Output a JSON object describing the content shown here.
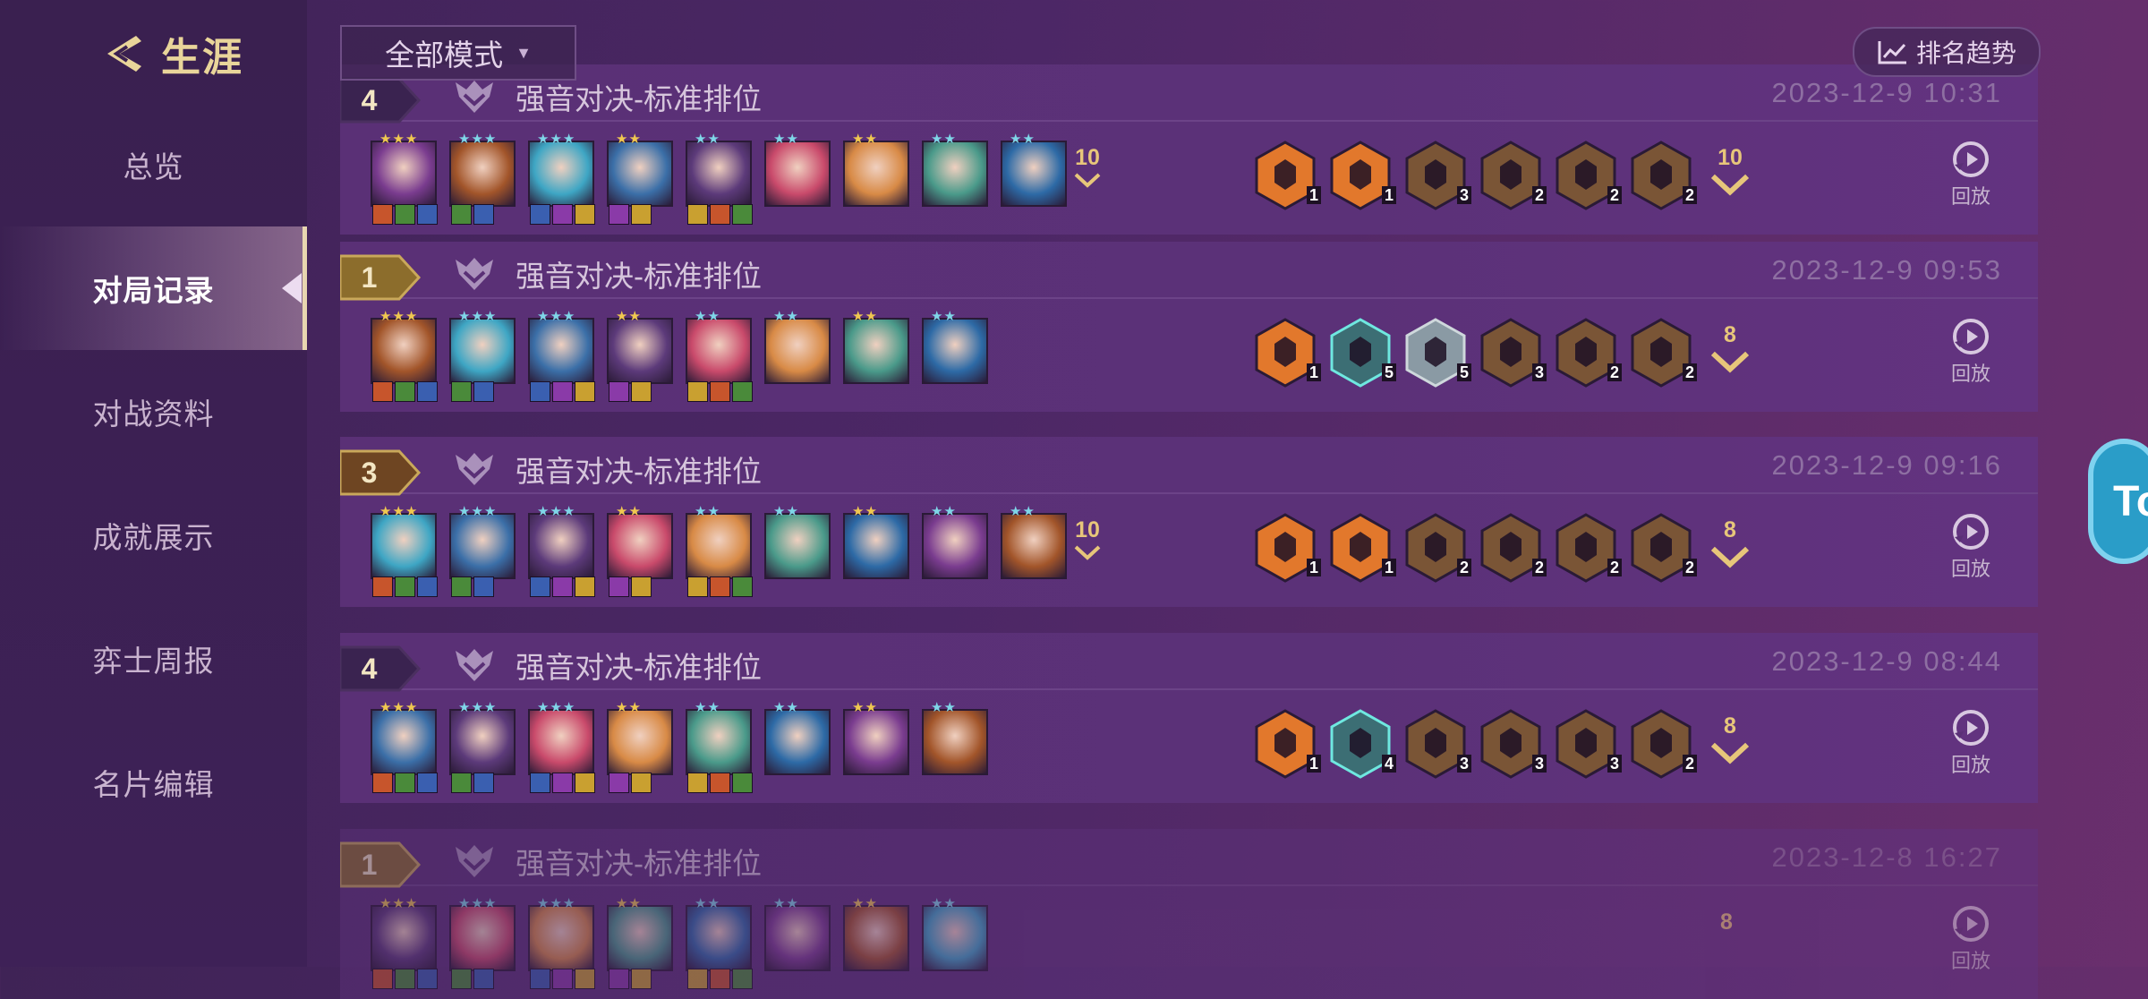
{
  "header": {
    "title": "生涯",
    "back_icon": "back-arrow-icon"
  },
  "sidebar": {
    "items": [
      {
        "label": "总览",
        "active": false
      },
      {
        "label": "对局记录",
        "active": true
      },
      {
        "label": "对战资料",
        "active": false
      },
      {
        "label": "成就展示",
        "active": false
      },
      {
        "label": "弈士周报",
        "active": false
      },
      {
        "label": "名片编辑",
        "active": false
      }
    ]
  },
  "filter": {
    "mode": "全部模式"
  },
  "trend_button": {
    "label": "排名趋势",
    "icon": "trend-chart-icon"
  },
  "side_tab": {
    "label": "To"
  },
  "colors": {
    "accent": "#e7c67a",
    "bg": "#4c2766",
    "card": "#5a3076",
    "rank_gold": "#8c6d2c",
    "rank_dark": "#3a2350"
  },
  "matches": [
    {
      "rank": "4",
      "mode": "强音对决-标准排位",
      "date": "2023-12-9 10:31",
      "level": "10",
      "trait_level": "10",
      "replay": "回放",
      "champ_count": 9,
      "trait_counts": [
        "1",
        "1",
        "3",
        "2",
        "2",
        "2"
      ]
    },
    {
      "rank": "1",
      "mode": "强音对决-标准排位",
      "date": "2023-12-9 09:53",
      "level": "",
      "trait_level": "8",
      "replay": "回放",
      "champ_count": 8,
      "trait_counts": [
        "1",
        "5",
        "5",
        "3",
        "2",
        "2"
      ]
    },
    {
      "rank": "3",
      "mode": "强音对决-标准排位",
      "date": "2023-12-9 09:16",
      "level": "10",
      "trait_level": "8",
      "replay": "回放",
      "champ_count": 9,
      "trait_counts": [
        "1",
        "1",
        "2",
        "2",
        "2",
        "2"
      ]
    },
    {
      "rank": "4",
      "mode": "强音对决-标准排位",
      "date": "2023-12-9 08:44",
      "level": "",
      "trait_level": "8",
      "replay": "回放",
      "champ_count": 8,
      "trait_counts": [
        "1",
        "4",
        "3",
        "3",
        "3",
        "2"
      ]
    },
    {
      "rank": "1",
      "mode": "强音对决-标准排位",
      "date": "2023-12-8 16:27",
      "level": "",
      "trait_level": "8",
      "replay": "回放",
      "champ_count": 8,
      "trait_counts": []
    }
  ]
}
